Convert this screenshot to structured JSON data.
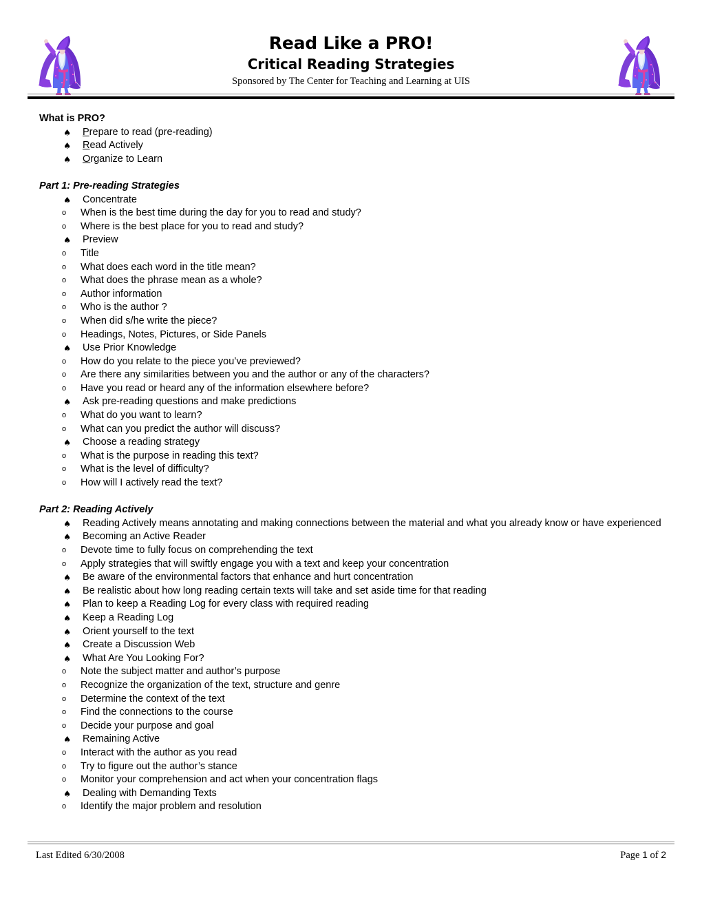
{
  "header": {
    "title": "Read Like a PRO!",
    "subtitle": "Critical Reading Strategies",
    "sponsor": "Sponsored by The Center for Teaching and Learning at UIS",
    "wizard_icon_left": "wizard-clipart",
    "wizard_icon_right": "wizard-clipart"
  },
  "bullets": {
    "level1_marker": "♠",
    "level2_marker": "o"
  },
  "sections": [
    {
      "heading": "What is PRO?",
      "heading_style": "bold",
      "items": [
        {
          "underline_first": 1,
          "text": "Prepare to read (pre-reading)",
          "sub": []
        },
        {
          "underline_first": 1,
          "text": "Read Actively",
          "sub": []
        },
        {
          "underline_first": 1,
          "text": "Organize to Learn",
          "sub": []
        }
      ]
    },
    {
      "heading": "Part 1: Pre-reading Strategies",
      "heading_style": "bold-italic",
      "items": [
        {
          "underline_first": 0,
          "text": "Concentrate",
          "sub": [
            "When is the best time during the day for you to read and study?",
            "Where is the best place for you to read and study?"
          ]
        },
        {
          "underline_first": 0,
          "text": "Preview",
          "sub": [
            "Title",
            "What does each word in the title mean?",
            "What does the phrase mean as a whole?",
            "Author information",
            "Who is the author ?",
            "When did s/he write the piece?",
            "Headings, Notes, Pictures, or Side Panels"
          ]
        },
        {
          "underline_first": 0,
          "text": "Use Prior Knowledge",
          "sub": [
            "How do you relate to the piece you’ve previewed?",
            "Are there any similarities between you and the author or any of the characters?",
            "Have you read or heard any of the information elsewhere before?"
          ]
        },
        {
          "underline_first": 0,
          "text": "Ask pre-reading questions and make predictions",
          "sub": [
            "What do you want to learn?",
            "What can you predict the author will discuss?"
          ]
        },
        {
          "underline_first": 0,
          "text": "Choose a reading strategy",
          "sub": [
            "What is the purpose in reading this text?",
            "What is the level of difficulty?",
            "How will I actively read the text?"
          ]
        }
      ]
    },
    {
      "heading": "Part 2: Reading Actively",
      "heading_style": "bold-italic",
      "items": [
        {
          "underline_first": 0,
          "text": "Reading Actively means annotating and making connections between the material and what you already know or have experienced",
          "sub": []
        },
        {
          "underline_first": 0,
          "text": "Becoming an Active Reader",
          "sub": [
            "Devote time to fully focus on comprehending the text",
            "Apply strategies that will swiftly engage you with a text and keep your concentration"
          ]
        },
        {
          "underline_first": 0,
          "text": "Be aware of the environmental factors that enhance and hurt concentration",
          "sub": []
        },
        {
          "underline_first": 0,
          "text": "Be realistic about how long reading certain texts will take and set aside time for that reading",
          "sub": []
        },
        {
          "underline_first": 0,
          "text": "Plan to keep a Reading Log for every class with required reading",
          "sub": []
        },
        {
          "underline_first": 0,
          "text": "Keep a Reading Log",
          "sub": []
        },
        {
          "underline_first": 0,
          "text": "Orient yourself to the text",
          "sub": []
        },
        {
          "underline_first": 0,
          "text": "Create a Discussion Web",
          "sub": []
        },
        {
          "underline_first": 0,
          "text": "What Are You Looking For?",
          "sub": [
            "Note the subject matter and author’s purpose",
            "Recognize the organization of the text, structure and genre",
            "Determine the context of the text",
            "Find the connections to the course",
            "Decide your purpose and goal"
          ]
        },
        {
          "underline_first": 0,
          "text": "Remaining Active",
          "sub": [
            "Interact with the author as you read",
            "Try to figure out the author’s stance",
            "Monitor your comprehension and act when your concentration flags"
          ]
        },
        {
          "underline_first": 0,
          "text": "Dealing with Demanding Texts",
          "sub": [
            "Identify the major problem and resolution"
          ]
        }
      ]
    }
  ],
  "footer": {
    "last_edited": "Last Edited 6/30/2008",
    "page_label_prefix": "Page ",
    "page_current": "1",
    "page_label_middle": " of ",
    "page_total": "2"
  }
}
